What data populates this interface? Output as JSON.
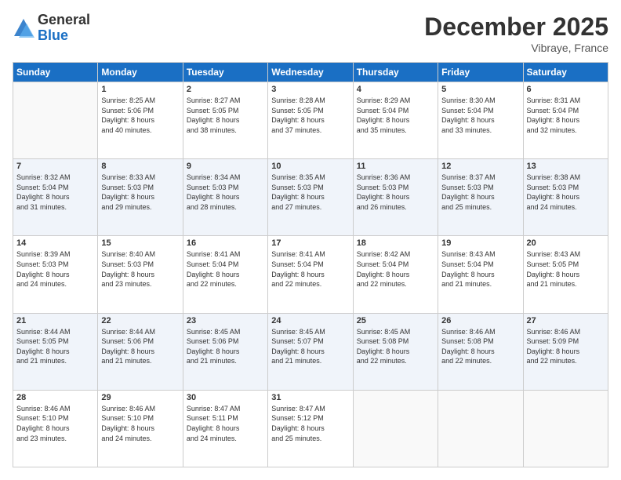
{
  "header": {
    "logo_general": "General",
    "logo_blue": "Blue",
    "month_title": "December 2025",
    "location": "Vibraye, France"
  },
  "weekdays": [
    "Sunday",
    "Monday",
    "Tuesday",
    "Wednesday",
    "Thursday",
    "Friday",
    "Saturday"
  ],
  "weeks": [
    [
      {
        "day": "",
        "info": ""
      },
      {
        "day": "1",
        "info": "Sunrise: 8:25 AM\nSunset: 5:06 PM\nDaylight: 8 hours\nand 40 minutes."
      },
      {
        "day": "2",
        "info": "Sunrise: 8:27 AM\nSunset: 5:05 PM\nDaylight: 8 hours\nand 38 minutes."
      },
      {
        "day": "3",
        "info": "Sunrise: 8:28 AM\nSunset: 5:05 PM\nDaylight: 8 hours\nand 37 minutes."
      },
      {
        "day": "4",
        "info": "Sunrise: 8:29 AM\nSunset: 5:04 PM\nDaylight: 8 hours\nand 35 minutes."
      },
      {
        "day": "5",
        "info": "Sunrise: 8:30 AM\nSunset: 5:04 PM\nDaylight: 8 hours\nand 33 minutes."
      },
      {
        "day": "6",
        "info": "Sunrise: 8:31 AM\nSunset: 5:04 PM\nDaylight: 8 hours\nand 32 minutes."
      }
    ],
    [
      {
        "day": "7",
        "info": "Sunrise: 8:32 AM\nSunset: 5:04 PM\nDaylight: 8 hours\nand 31 minutes."
      },
      {
        "day": "8",
        "info": "Sunrise: 8:33 AM\nSunset: 5:03 PM\nDaylight: 8 hours\nand 29 minutes."
      },
      {
        "day": "9",
        "info": "Sunrise: 8:34 AM\nSunset: 5:03 PM\nDaylight: 8 hours\nand 28 minutes."
      },
      {
        "day": "10",
        "info": "Sunrise: 8:35 AM\nSunset: 5:03 PM\nDaylight: 8 hours\nand 27 minutes."
      },
      {
        "day": "11",
        "info": "Sunrise: 8:36 AM\nSunset: 5:03 PM\nDaylight: 8 hours\nand 26 minutes."
      },
      {
        "day": "12",
        "info": "Sunrise: 8:37 AM\nSunset: 5:03 PM\nDaylight: 8 hours\nand 25 minutes."
      },
      {
        "day": "13",
        "info": "Sunrise: 8:38 AM\nSunset: 5:03 PM\nDaylight: 8 hours\nand 24 minutes."
      }
    ],
    [
      {
        "day": "14",
        "info": "Sunrise: 8:39 AM\nSunset: 5:03 PM\nDaylight: 8 hours\nand 24 minutes."
      },
      {
        "day": "15",
        "info": "Sunrise: 8:40 AM\nSunset: 5:03 PM\nDaylight: 8 hours\nand 23 minutes."
      },
      {
        "day": "16",
        "info": "Sunrise: 8:41 AM\nSunset: 5:04 PM\nDaylight: 8 hours\nand 22 minutes."
      },
      {
        "day": "17",
        "info": "Sunrise: 8:41 AM\nSunset: 5:04 PM\nDaylight: 8 hours\nand 22 minutes."
      },
      {
        "day": "18",
        "info": "Sunrise: 8:42 AM\nSunset: 5:04 PM\nDaylight: 8 hours\nand 22 minutes."
      },
      {
        "day": "19",
        "info": "Sunrise: 8:43 AM\nSunset: 5:04 PM\nDaylight: 8 hours\nand 21 minutes."
      },
      {
        "day": "20",
        "info": "Sunrise: 8:43 AM\nSunset: 5:05 PM\nDaylight: 8 hours\nand 21 minutes."
      }
    ],
    [
      {
        "day": "21",
        "info": "Sunrise: 8:44 AM\nSunset: 5:05 PM\nDaylight: 8 hours\nand 21 minutes."
      },
      {
        "day": "22",
        "info": "Sunrise: 8:44 AM\nSunset: 5:06 PM\nDaylight: 8 hours\nand 21 minutes."
      },
      {
        "day": "23",
        "info": "Sunrise: 8:45 AM\nSunset: 5:06 PM\nDaylight: 8 hours\nand 21 minutes."
      },
      {
        "day": "24",
        "info": "Sunrise: 8:45 AM\nSunset: 5:07 PM\nDaylight: 8 hours\nand 21 minutes."
      },
      {
        "day": "25",
        "info": "Sunrise: 8:45 AM\nSunset: 5:08 PM\nDaylight: 8 hours\nand 22 minutes."
      },
      {
        "day": "26",
        "info": "Sunrise: 8:46 AM\nSunset: 5:08 PM\nDaylight: 8 hours\nand 22 minutes."
      },
      {
        "day": "27",
        "info": "Sunrise: 8:46 AM\nSunset: 5:09 PM\nDaylight: 8 hours\nand 22 minutes."
      }
    ],
    [
      {
        "day": "28",
        "info": "Sunrise: 8:46 AM\nSunset: 5:10 PM\nDaylight: 8 hours\nand 23 minutes."
      },
      {
        "day": "29",
        "info": "Sunrise: 8:46 AM\nSunset: 5:10 PM\nDaylight: 8 hours\nand 24 minutes."
      },
      {
        "day": "30",
        "info": "Sunrise: 8:47 AM\nSunset: 5:11 PM\nDaylight: 8 hours\nand 24 minutes."
      },
      {
        "day": "31",
        "info": "Sunrise: 8:47 AM\nSunset: 5:12 PM\nDaylight: 8 hours\nand 25 minutes."
      },
      {
        "day": "",
        "info": ""
      },
      {
        "day": "",
        "info": ""
      },
      {
        "day": "",
        "info": ""
      }
    ]
  ]
}
